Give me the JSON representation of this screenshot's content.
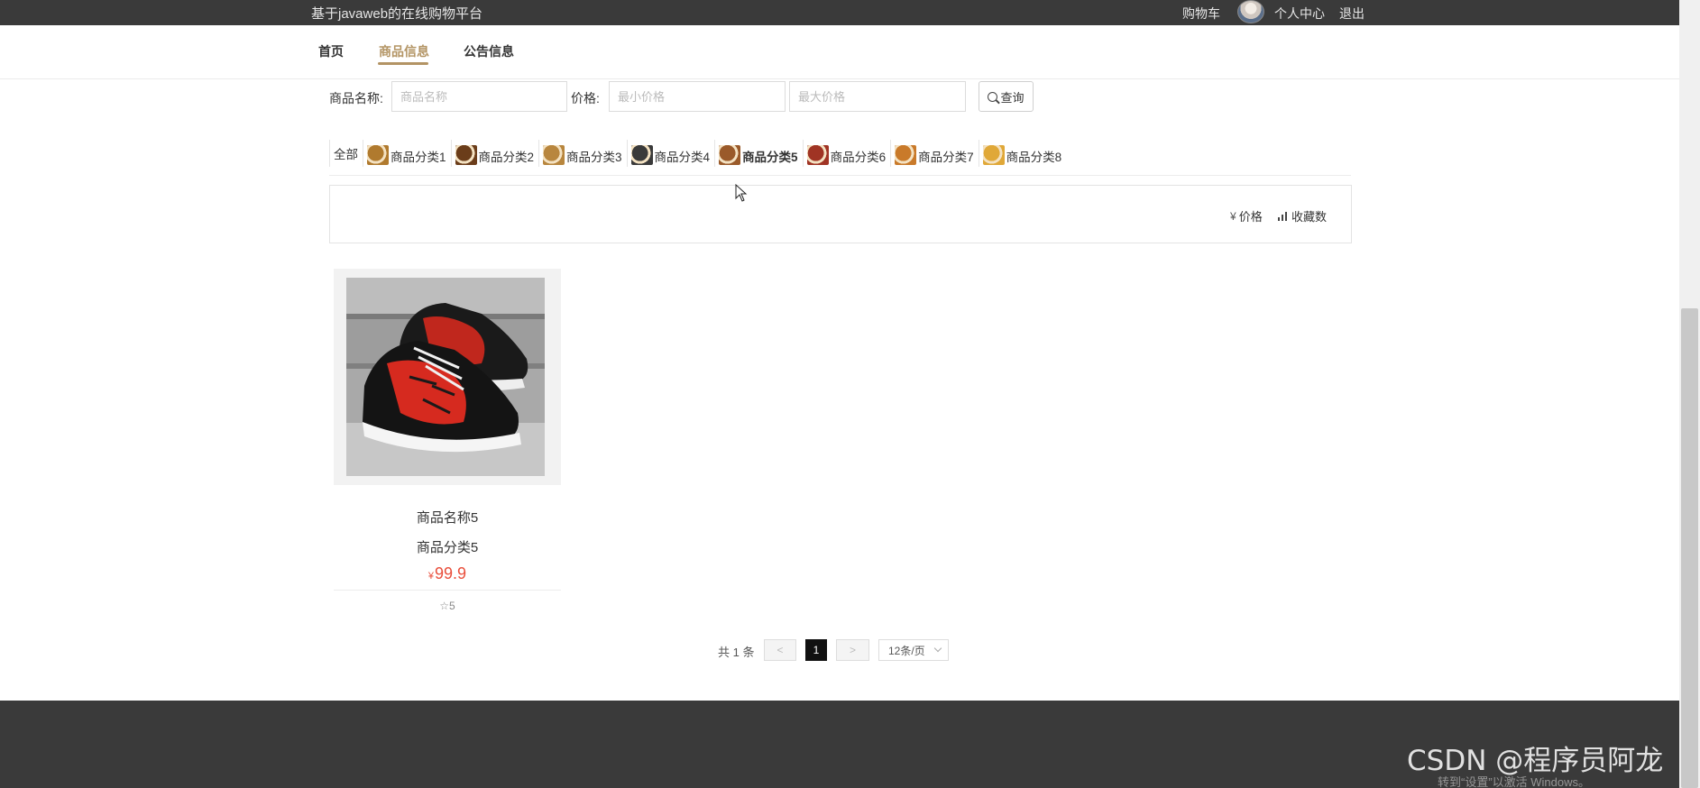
{
  "header": {
    "site_title": "基于javaweb的在线购物平台",
    "cart_label": "购物车",
    "profile_label": "个人中心",
    "logout_label": "退出"
  },
  "nav": {
    "items": [
      {
        "label": "首页",
        "active": false
      },
      {
        "label": "商品信息",
        "active": true
      },
      {
        "label": "公告信息",
        "active": false
      }
    ]
  },
  "search": {
    "name_label": "商品名称:",
    "name_placeholder": "商品名称",
    "price_label": "价格:",
    "min_placeholder": "最小价格",
    "max_placeholder": "最大价格",
    "button_label": "查询"
  },
  "categories": {
    "all_label": "全部",
    "items": [
      {
        "label": "商品分类1",
        "thumb_color": "#b07a2e",
        "active": false
      },
      {
        "label": "商品分类2",
        "thumb_color": "#6b3d1a",
        "active": false
      },
      {
        "label": "商品分类3",
        "thumb_color": "#b8863e",
        "active": false
      },
      {
        "label": "商品分类4",
        "thumb_color": "#3a3a3a",
        "active": false
      },
      {
        "label": "商品分类5",
        "thumb_color": "#9a5a2a",
        "active": true
      },
      {
        "label": "商品分类6",
        "thumb_color": "#a03424",
        "active": false
      },
      {
        "label": "商品分类7",
        "thumb_color": "#c97a2a",
        "active": false
      },
      {
        "label": "商品分类8",
        "thumb_color": "#e0a838",
        "active": false
      }
    ]
  },
  "sort": {
    "price_label": "价格",
    "favorites_label": "收藏数"
  },
  "products": [
    {
      "name": "商品名称5",
      "category": "商品分类5",
      "currency": "¥",
      "price": "99.9",
      "favorites": "5"
    }
  ],
  "pagination": {
    "total_text": "共 1 条",
    "prev_label": "<",
    "current_page": "1",
    "next_label": ">",
    "page_size": "12条/页"
  },
  "overlay": {
    "watermark": "CSDN @程序员阿龙",
    "activate_text": "转到“设置”以激活 Windows。"
  },
  "colors": {
    "accent": "#b39464",
    "price": "#e94e3b",
    "topbar": "#3a3a3a"
  }
}
